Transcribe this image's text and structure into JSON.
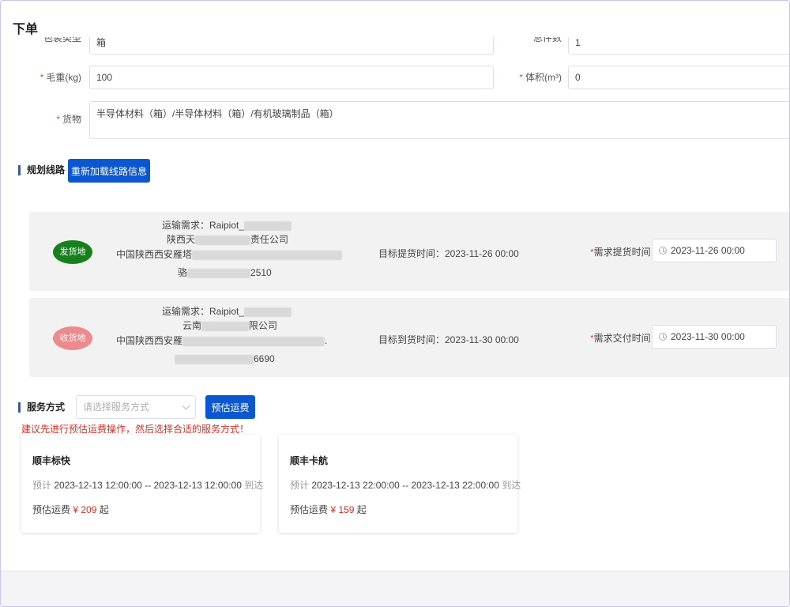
{
  "page": {
    "title": "下单"
  },
  "form": {
    "pack_type": {
      "label": "包装类型",
      "value": "箱"
    },
    "total_pieces": {
      "label": "总件数",
      "value": "1"
    },
    "gross_weight": {
      "label": "毛重(kg)",
      "value": "100"
    },
    "volume": {
      "label": "体积(m³)",
      "value": "0"
    },
    "goods": {
      "label": "货物",
      "value": "半导体材料（箱）/半导体材料（箱）/有机玻璃制品（箱）"
    },
    "required_mark": "*"
  },
  "route": {
    "section_title": "规划线路",
    "reload_button": "重新加载线路信息",
    "origin": {
      "badge": "发货地",
      "demand": "运输需求：Raipiot_",
      "company_prefix": "陕西天",
      "company_suffix": "责任公司",
      "address_prefix": "中国陕西西安雁塔",
      "contact_prefix": "骆",
      "contact_suffix": "2510",
      "target_time": "目标提货时间：2023-11-26 00:00",
      "need_label": "需求提货时间",
      "need_value": "2023-11-26 00:00",
      "badge_color": "#17801c"
    },
    "dest": {
      "badge": "收货地",
      "demand": "运输需求：Raipiot_",
      "company_prefix": "云南",
      "company_suffix": "限公司",
      "address_prefix": "中国陕西西安雁",
      "address_suffix": ".",
      "contact_suffix": "6690",
      "target_time": "目标到货时间：2023-11-30 00:00",
      "need_label": "需求交付时间",
      "need_value": "2023-11-30 00:00",
      "badge_color": "#ec8a8e"
    }
  },
  "service": {
    "section_title": "服务方式",
    "placeholder": "请选择服务方式",
    "estimate_button": "预估运费",
    "warning": "建议先进行预估运费操作，然后选择合适的服务方式！",
    "options": [
      {
        "name": "顺丰标快",
        "eta_prefix": "预计",
        "eta_range": "2023-12-13 12:00:00 -- 2023-12-13 12:00:00",
        "eta_suffix": "到达",
        "fee_label": "预估运费",
        "fee_value": "¥ 209",
        "fee_suffix": "起"
      },
      {
        "name": "顺丰卡航",
        "eta_prefix": "预计",
        "eta_range": "2023-12-13 22:00:00 -- 2023-12-13 22:00:00",
        "eta_suffix": "到达",
        "fee_label": "预估运费",
        "fee_value": "¥ 159",
        "fee_suffix": "起"
      }
    ]
  },
  "colors": {
    "primary": "#0b57d0",
    "danger": "#d93025",
    "accent_bar": "#1f5fd1"
  }
}
